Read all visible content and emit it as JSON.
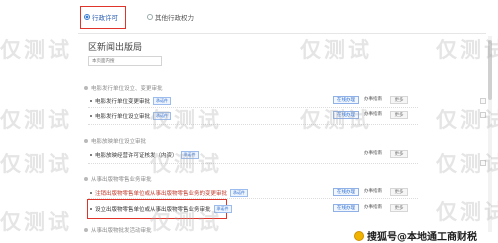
{
  "tabs": {
    "selected_label": "行政许可",
    "other_label": "其他行政权力"
  },
  "dept_title": "区新闻出版局",
  "search": {
    "placeholder": "本页面内搜"
  },
  "sections": [
    {
      "title": "电影发行单位设立、变更审批",
      "items": [
        {
          "name": "电影发行单位变更审批",
          "tag": "承诺件",
          "actions": [
            "在线办理",
            "办事指南",
            "更多"
          ]
        },
        {
          "name": "电影发行单位设立审批",
          "tag": "承诺件",
          "actions": [
            "在线办理",
            "办事指南",
            "更多"
          ]
        }
      ]
    },
    {
      "title": "电影放映单位设立审批",
      "items": [
        {
          "name": "电影放映经营许可证核发（内资）",
          "tag": "承诺件",
          "actions": [
            "办事指南",
            "更多"
          ]
        }
      ]
    },
    {
      "title": "从事出版物零售业务审批",
      "items": [
        {
          "name": "注销出版物零售单位或从事出版物零售业务的变更审批",
          "tag": "承诺件",
          "actions": [
            "在线办理",
            "办事指南",
            "更多"
          ]
        },
        {
          "name": "设立出版物零售单位或从事出版物零售业务审批",
          "tag": "承诺件",
          "actions": [
            "在线办理",
            "办事指南",
            "更多"
          ]
        }
      ]
    },
    {
      "title": "从事出版物批发活动审批",
      "items": []
    }
  ],
  "watermark": "仅测试",
  "credit": "搜狐号@本地通工商财税",
  "colors": {
    "highlight": "#e0342a",
    "accent": "#2f6fd1",
    "warning_text": "#c0392b"
  },
  "icons": {
    "section": "dot-icon",
    "credit": "sohu-logo-icon"
  }
}
